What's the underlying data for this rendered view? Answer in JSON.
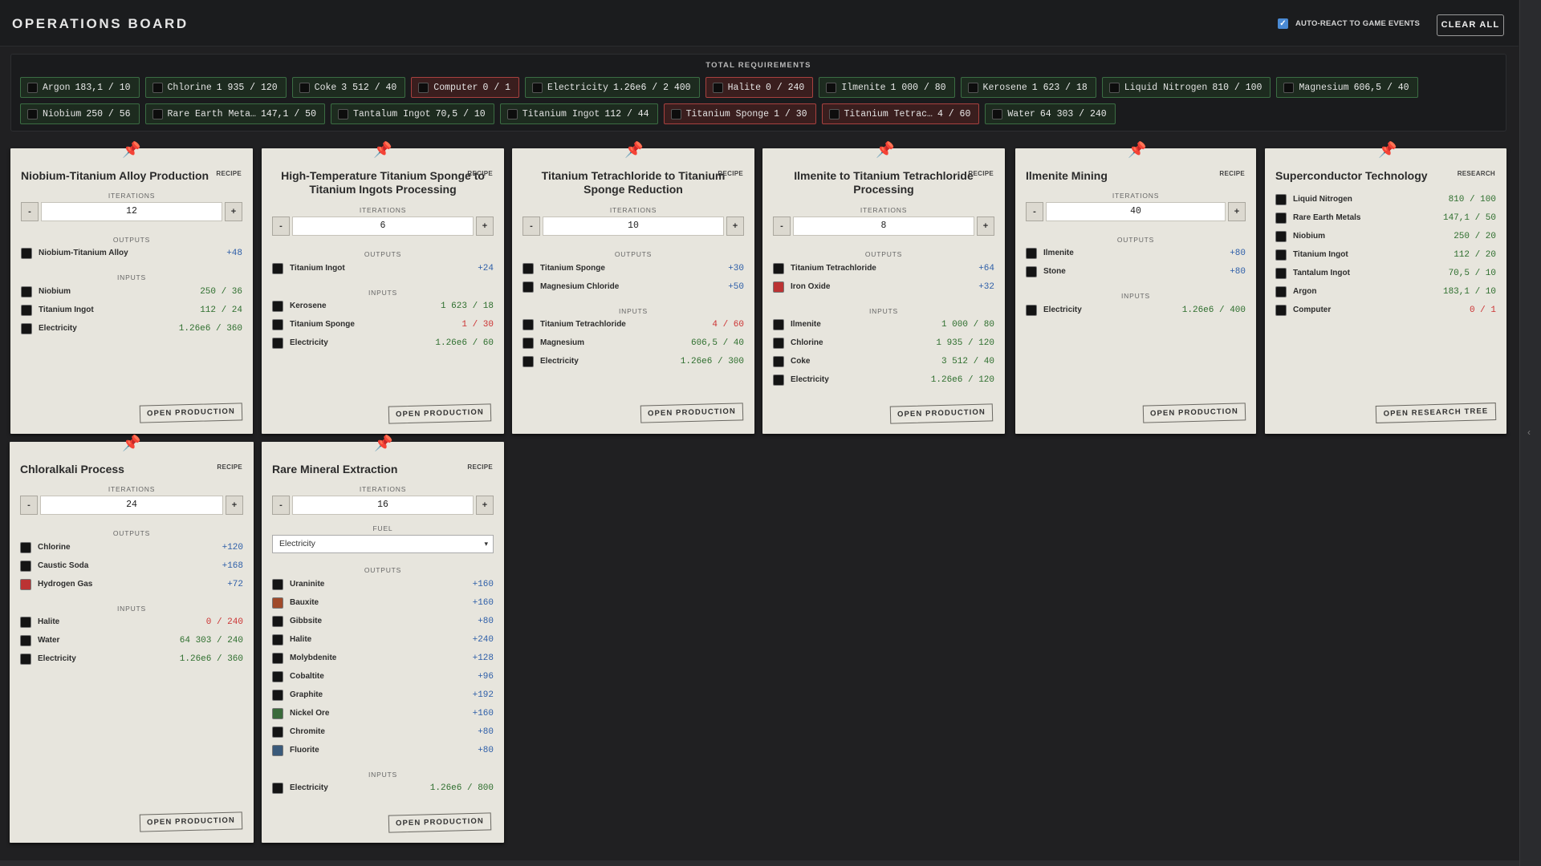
{
  "header": {
    "title": "OPERATIONS BOARD",
    "auto_react_label": "AUTO-REACT TO GAME EVENTS",
    "auto_react_checked": true,
    "clear_all": "CLEAR ALL"
  },
  "requirements": {
    "title": "TOTAL REQUIREMENTS",
    "items": [
      {
        "name": "Argon",
        "value": "183,1 / 10",
        "ok": true
      },
      {
        "name": "Chlorine",
        "value": "1 935 / 120",
        "ok": true
      },
      {
        "name": "Coke",
        "value": "3 512 / 40",
        "ok": true
      },
      {
        "name": "Computer",
        "value": "0 / 1",
        "ok": false
      },
      {
        "name": "Electricity",
        "value": "1.26e6 / 2 400",
        "ok": true
      },
      {
        "name": "Halite",
        "value": "0 / 240",
        "ok": false
      },
      {
        "name": "Ilmenite",
        "value": "1 000 / 80",
        "ok": true
      },
      {
        "name": "Kerosene",
        "value": "1 623 / 18",
        "ok": true
      },
      {
        "name": "Liquid Nitrogen",
        "value": "810 / 100",
        "ok": true
      },
      {
        "name": "Magnesium",
        "value": "606,5 / 40",
        "ok": true
      },
      {
        "name": "Niobium",
        "value": "250 / 56",
        "ok": true
      },
      {
        "name": "Rare Earth Meta…",
        "value": "147,1 / 50",
        "ok": true
      },
      {
        "name": "Tantalum Ingot",
        "value": "70,5 / 10",
        "ok": true
      },
      {
        "name": "Titanium Ingot",
        "value": "112 / 44",
        "ok": true
      },
      {
        "name": "Titanium Sponge",
        "value": "1 / 30",
        "ok": false
      },
      {
        "name": "Titanium Tetrac…",
        "value": "4 / 60",
        "ok": false
      },
      {
        "name": "Water",
        "value": "64 303 / 240",
        "ok": true
      }
    ]
  },
  "labels": {
    "iterations": "ITERATIONS",
    "outputs": "OUTPUTS",
    "inputs": "INPUTS",
    "fuel": "FUEL",
    "minus": "-",
    "plus": "+",
    "open_production": "OPEN PRODUCTION",
    "open_research": "OPEN RESEARCH TREE"
  },
  "cards": [
    {
      "title": "Niobium-Titanium Alloy Production",
      "type": "RECIPE",
      "iterations": "12",
      "outputs": [
        {
          "name": "Niobium-Titanium Alloy",
          "value": "+48"
        }
      ],
      "inputs": [
        {
          "name": "Niobium",
          "value": "250 / 36",
          "ok": true
        },
        {
          "name": "Titanium Ingot",
          "value": "112 / 24",
          "ok": true
        },
        {
          "name": "Electricity",
          "value": "1.26e6 / 360",
          "ok": true
        }
      ]
    },
    {
      "title": "High-Temperature Titanium Sponge to Titanium Ingots Processing",
      "type": "RECIPE",
      "iterations": "6",
      "outputs": [
        {
          "name": "Titanium Ingot",
          "value": "+24"
        }
      ],
      "inputs": [
        {
          "name": "Kerosene",
          "value": "1 623 / 18",
          "ok": true
        },
        {
          "name": "Titanium Sponge",
          "value": "1 / 30",
          "ok": false
        },
        {
          "name": "Electricity",
          "value": "1.26e6 / 60",
          "ok": true
        }
      ]
    },
    {
      "title": "Titanium Tetrachloride to Titanium Sponge Reduction",
      "type": "RECIPE",
      "iterations": "10",
      "outputs": [
        {
          "name": "Titanium Sponge",
          "value": "+30"
        },
        {
          "name": "Magnesium Chloride",
          "value": "+50"
        }
      ],
      "inputs": [
        {
          "name": "Titanium Tetrachloride",
          "value": "4 / 60",
          "ok": false
        },
        {
          "name": "Magnesium",
          "value": "606,5 / 40",
          "ok": true
        },
        {
          "name": "Electricity",
          "value": "1.26e6 / 300",
          "ok": true
        }
      ]
    },
    {
      "title": "Ilmenite to Titanium Tetrachloride Processing",
      "type": "RECIPE",
      "iterations": "8",
      "outputs": [
        {
          "name": "Titanium Tetrachloride",
          "value": "+64"
        },
        {
          "name": "Iron Oxide",
          "value": "+32"
        }
      ],
      "inputs": [
        {
          "name": "Ilmenite",
          "value": "1 000 / 80",
          "ok": true
        },
        {
          "name": "Chlorine",
          "value": "1 935 / 120",
          "ok": true
        },
        {
          "name": "Coke",
          "value": "3 512 / 40",
          "ok": true
        },
        {
          "name": "Electricity",
          "value": "1.26e6 / 120",
          "ok": true
        }
      ]
    },
    {
      "title": "Ilmenite Mining",
      "type": "RECIPE",
      "iterations": "40",
      "outputs": [
        {
          "name": "Ilmenite",
          "value": "+80"
        },
        {
          "name": "Stone",
          "value": "+80"
        }
      ],
      "inputs": [
        {
          "name": "Electricity",
          "value": "1.26e6 / 400",
          "ok": true
        }
      ]
    },
    {
      "title": "Superconductor Technology",
      "type": "RESEARCH",
      "requirements": [
        {
          "name": "Liquid Nitrogen",
          "value": "810 / 100",
          "ok": true
        },
        {
          "name": "Rare Earth Metals",
          "value": "147,1 / 50",
          "ok": true
        },
        {
          "name": "Niobium",
          "value": "250 / 20",
          "ok": true
        },
        {
          "name": "Titanium Ingot",
          "value": "112 / 20",
          "ok": true
        },
        {
          "name": "Tantalum Ingot",
          "value": "70,5 / 10",
          "ok": true
        },
        {
          "name": "Argon",
          "value": "183,1 / 10",
          "ok": true
        },
        {
          "name": "Computer",
          "value": "0 / 1",
          "ok": false
        }
      ]
    },
    {
      "title": "Chloralkali Process",
      "type": "RECIPE",
      "iterations": "24",
      "outputs": [
        {
          "name": "Chlorine",
          "value": "+120"
        },
        {
          "name": "Caustic Soda",
          "value": "+168"
        },
        {
          "name": "Hydrogen Gas",
          "value": "+72"
        }
      ],
      "inputs": [
        {
          "name": "Halite",
          "value": "0 / 240",
          "ok": false
        },
        {
          "name": "Water",
          "value": "64 303 / 240",
          "ok": true
        },
        {
          "name": "Electricity",
          "value": "1.26e6 / 360",
          "ok": true
        }
      ]
    },
    {
      "title": "Rare Mineral Extraction",
      "type": "RECIPE",
      "iterations": "16",
      "fuel": "Electricity",
      "outputs": [
        {
          "name": "Uraninite",
          "value": "+160"
        },
        {
          "name": "Bauxite",
          "value": "+160"
        },
        {
          "name": "Gibbsite",
          "value": "+80"
        },
        {
          "name": "Halite",
          "value": "+240"
        },
        {
          "name": "Molybdenite",
          "value": "+128"
        },
        {
          "name": "Cobaltite",
          "value": "+96"
        },
        {
          "name": "Graphite",
          "value": "+192"
        },
        {
          "name": "Nickel Ore",
          "value": "+160"
        },
        {
          "name": "Chromite",
          "value": "+80"
        },
        {
          "name": "Fluorite",
          "value": "+80"
        }
      ],
      "inputs": [
        {
          "name": "Electricity",
          "value": "1.26e6 / 800",
          "ok": true
        }
      ]
    }
  ]
}
